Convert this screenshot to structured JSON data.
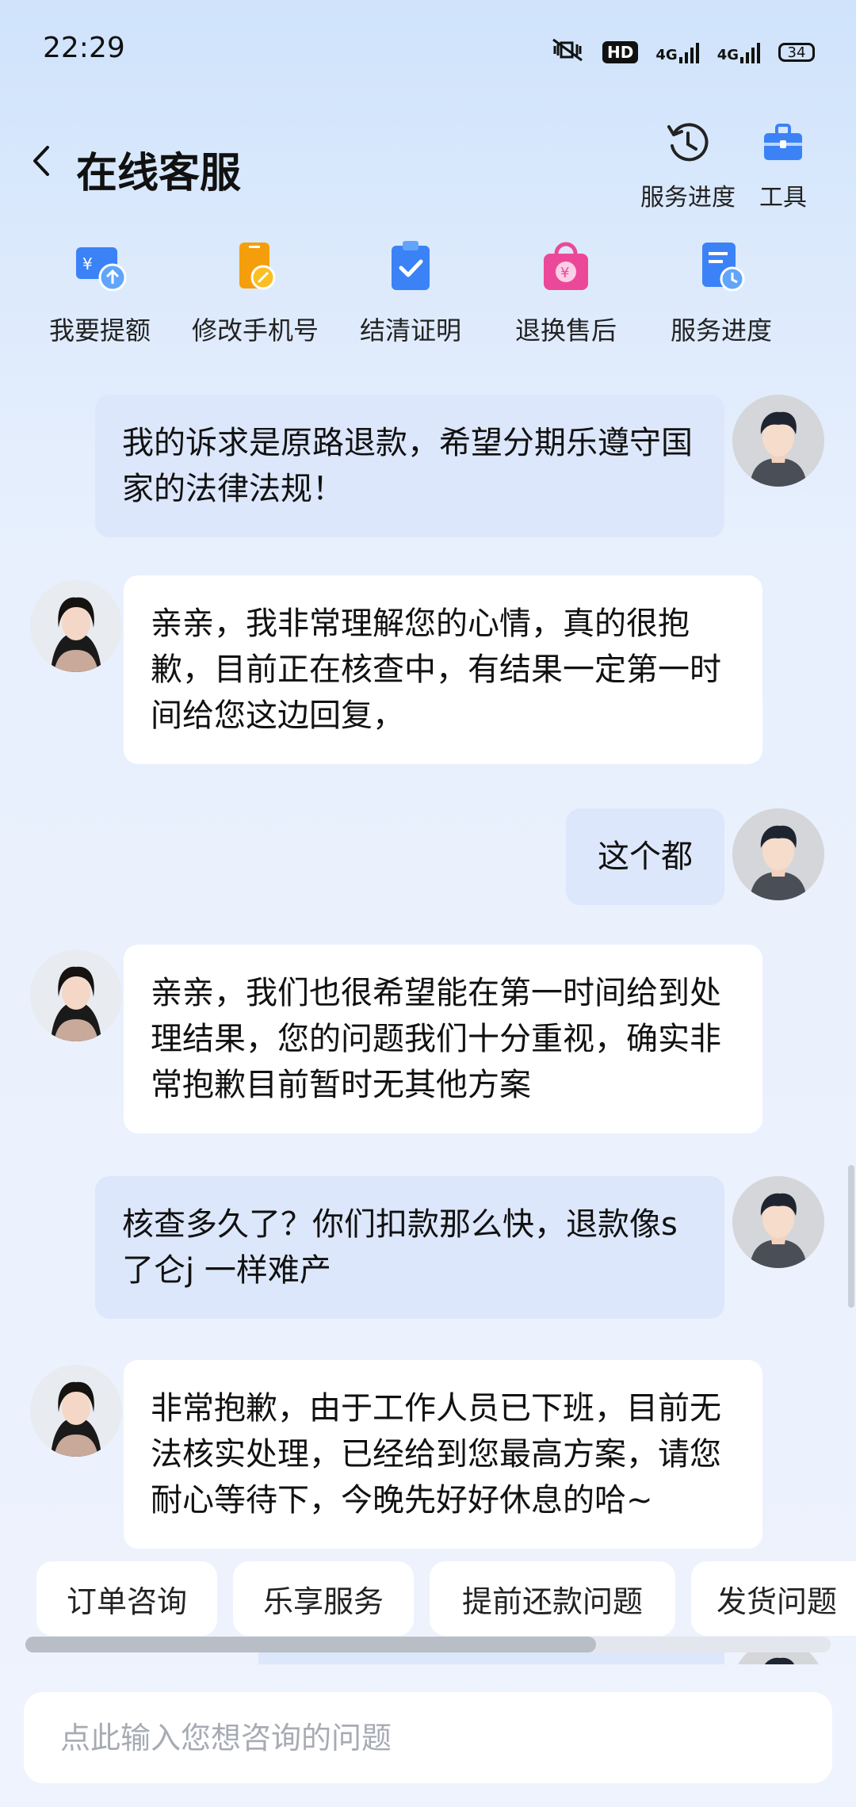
{
  "status_bar": {
    "time": "22:29",
    "icons": [
      "mute-vibrate-icon",
      "hd-icon",
      "4g-signal-icon",
      "4g-signal-icon",
      "battery-icon"
    ],
    "hd_text": "HD",
    "net1": "4G",
    "net2": "4G",
    "battery": "34"
  },
  "header": {
    "title": "在线客服",
    "tools": [
      {
        "label": "服务进度",
        "icon": "clock-history-icon"
      },
      {
        "label": "工具",
        "icon": "toolbox-icon"
      }
    ]
  },
  "shortcuts": [
    {
      "label": "我要提额",
      "icon": "credit-increase-icon",
      "color": "#3b82f6"
    },
    {
      "label": "修改手机号",
      "icon": "phone-edit-icon",
      "color": "#f59e0b"
    },
    {
      "label": "结清证明",
      "icon": "clipboard-check-icon",
      "color": "#3b82f6"
    },
    {
      "label": "退换售后",
      "icon": "shopping-bag-yen-icon",
      "color": "#ec4899"
    },
    {
      "label": "服务进度",
      "icon": "document-clock-icon",
      "color": "#3b82f6"
    }
  ],
  "messages": [
    {
      "from": "user",
      "text": "我的诉求是原路退款，希望分期乐遵守国家的法律法规！"
    },
    {
      "from": "agent",
      "text": "亲亲，我非常理解您的心情，真的很抱歉，目前正在核查中，有结果一定第一时间给您这边回复，"
    },
    {
      "from": "user",
      "text": "这个都"
    },
    {
      "from": "agent",
      "text": "亲亲，我们也很希望能在第一时间给到处理结果，您的问题我们十分重视，确实非常抱歉目前暂时无其他方案"
    },
    {
      "from": "user",
      "text": "核查多久了？你们扣款那么快，退款像s了仑j 一样难产"
    },
    {
      "from": "agent",
      "text": "非常抱歉，由于工作人员已下班，目前无法核实处理，已经给到您最高方案，请您耐心等待下，今晚先好好休息的哈~"
    }
  ],
  "quick_replies": [
    "订单咨询",
    "乐享服务",
    "提前还款问题",
    "发货问题"
  ],
  "input": {
    "placeholder": "点此输入您想咨询的问题",
    "value": ""
  },
  "colors": {
    "accent": "#3b82f6",
    "user_bubble": "#dde7fb",
    "agent_bubble": "#ffffff"
  }
}
